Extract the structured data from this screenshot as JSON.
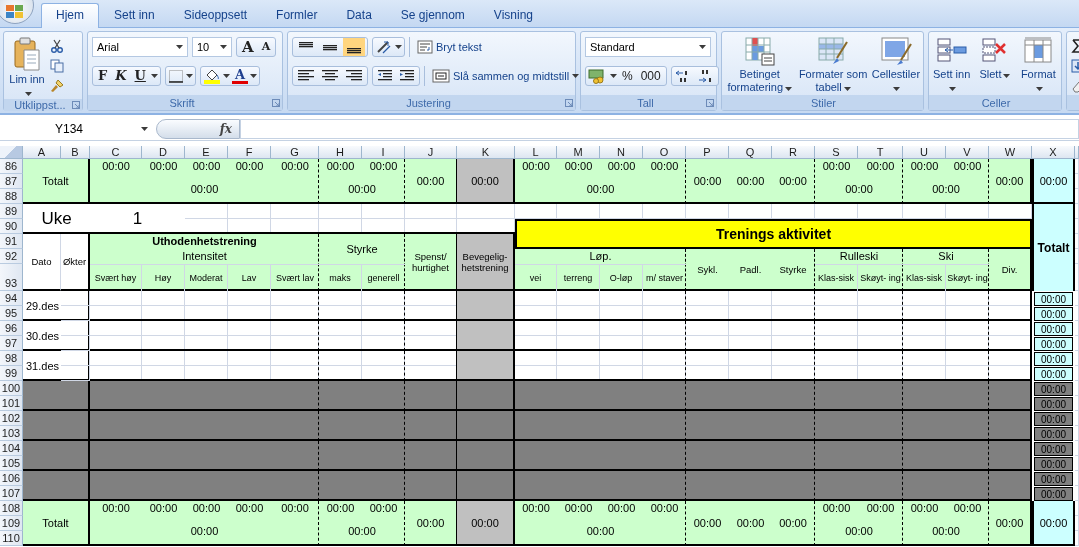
{
  "tabs": [
    {
      "label": "Hjem",
      "selected": true
    },
    {
      "label": "Sett inn",
      "selected": false
    },
    {
      "label": "Sideoppsett",
      "selected": false
    },
    {
      "label": "Formler",
      "selected": false
    },
    {
      "label": "Data",
      "selected": false
    },
    {
      "label": "Se gjennom",
      "selected": false
    },
    {
      "label": "Visning",
      "selected": false
    }
  ],
  "ribbon": {
    "clipboard": {
      "paste": "Lim inn",
      "label": "Utklippst..."
    },
    "font": {
      "name": "Arial",
      "size": "10",
      "grow": "A",
      "shrink": "A",
      "bold": "F",
      "italic": "K",
      "underline": "U",
      "text_color": "A",
      "label": "Skrift"
    },
    "alignment": {
      "vertical": [
        {
          "selected": false
        },
        {
          "selected": false
        },
        {
          "selected": true
        }
      ],
      "wrap": "Bryt tekst",
      "merge": "Slå sammen og midtstill",
      "label": "Justering"
    },
    "number": {
      "format": "Standard",
      "percent": "%",
      "thousands": "000",
      "label": "Tall"
    },
    "styles": {
      "buttons": [
        {
          "label": "Betinget formatering",
          "kind": "conditional"
        },
        {
          "label": "Formater som tabell",
          "kind": "table"
        },
        {
          "label": "Cellestiler",
          "kind": "cellstyle"
        }
      ],
      "label": "Stiler"
    },
    "cells": {
      "buttons": [
        {
          "label": "Sett inn",
          "kind": "insert"
        },
        {
          "label": "Slett",
          "kind": "delete"
        },
        {
          "label": "Format",
          "kind": "format"
        }
      ],
      "label": "Celler"
    }
  },
  "formula_bar": {
    "name_box": "Y134",
    "function_label": "fx"
  },
  "sheet": {
    "columns": [
      "A",
      "B",
      "C",
      "D",
      "E",
      "F",
      "G",
      "H",
      "I",
      "J",
      "K",
      "L",
      "M",
      "N",
      "O",
      "P",
      "Q",
      "R",
      "S",
      "T",
      "U",
      "V",
      "W",
      "X"
    ],
    "rows": [
      "86",
      "87",
      "88",
      "89",
      "90",
      "91",
      "92",
      "93",
      "94",
      "95",
      "96",
      "97",
      "98",
      "99",
      "100",
      "101",
      "102",
      "103",
      "104",
      "105",
      "106",
      "107",
      "108",
      "109",
      "110"
    ],
    "top_totals": {
      "label": "Totalt",
      "groups": [
        {
          "kind": "activity",
          "values": [
            "00:00",
            "00:00",
            "00:00",
            "00:00",
            "00:00"
          ],
          "subtotal": "00:00"
        },
        {
          "kind": "activity",
          "values": [
            "00:00",
            "00:00"
          ],
          "subtotal": "00:00"
        },
        {
          "kind": "activity",
          "values": [
            "00:00"
          ]
        },
        {
          "kind": "mobility",
          "values": [
            "00:00"
          ]
        },
        {
          "kind": "activity",
          "values": [
            "00:00",
            "00:00",
            "00:00",
            "00:00"
          ],
          "subtotal": "00:00"
        },
        {
          "kind": "activity",
          "values": [
            "00:00"
          ]
        },
        {
          "kind": "activity",
          "values": [
            "00:00"
          ]
        },
        {
          "kind": "activity",
          "values": [
            "00:00"
          ]
        },
        {
          "kind": "activity",
          "values": [
            "00:00",
            "00:00"
          ],
          "subtotal": "00:00"
        },
        {
          "kind": "activity",
          "values": [
            "00:00",
            "00:00"
          ],
          "subtotal": "00:00"
        },
        {
          "kind": "activity",
          "values": [
            "00:00"
          ]
        },
        {
          "kind": "sum",
          "values": [
            "00:00"
          ]
        }
      ]
    },
    "week": {
      "label": "Uke",
      "number": "1"
    },
    "activity_banner": "Trenings aktivitet",
    "total_header": "Totalt",
    "row_headers": [
      "Dato",
      "Økter"
    ],
    "header_groups": [
      {
        "kind": "activity",
        "title": "Uthodenhetstrening",
        "bold": true,
        "subtitle": "Intensitet",
        "columns": [
          "Svært høy",
          "Høy",
          "Moderat",
          "Lav",
          "Svært lav"
        ]
      },
      {
        "kind": "activity",
        "title": "Styrke",
        "columns": [
          "maks",
          "generell"
        ]
      },
      {
        "kind": "activity",
        "title": "Spenst/ hurtighet"
      },
      {
        "kind": "mobility",
        "title": "Bevegelig- hetstrening"
      },
      {
        "kind": "activity",
        "title": "Løp.",
        "columns": [
          "vei",
          "terreng",
          "O-løp",
          "m/ staver"
        ]
      },
      {
        "kind": "activity",
        "title": "Sykl."
      },
      {
        "kind": "activity",
        "title": "Padl."
      },
      {
        "kind": "activity",
        "title": "Styrke"
      },
      {
        "kind": "activity",
        "title": "Rulleski",
        "columns": [
          "Klas-sisk",
          "Skøyt- ing"
        ]
      },
      {
        "kind": "activity",
        "title": "Ski",
        "columns": [
          "Klas-sisk",
          "Skøyt- ing"
        ]
      },
      {
        "kind": "activity",
        "title": "Div."
      }
    ],
    "days": [
      {
        "label": "29.des",
        "kind": "open",
        "totals": [
          "00:00",
          "00:00"
        ]
      },
      {
        "label": "30.des",
        "kind": "open",
        "totals": [
          "00:00",
          "00:00"
        ]
      },
      {
        "label": "31.des",
        "kind": "open",
        "totals": [
          "00:00",
          "00:00"
        ]
      },
      {
        "kind": "blocked",
        "totals": [
          "00:00",
          "00:00"
        ]
      },
      {
        "kind": "blocked",
        "totals": [
          "00:00",
          "00:00"
        ]
      },
      {
        "kind": "blocked",
        "totals": [
          "00:00",
          "00:00"
        ]
      },
      {
        "kind": "blocked",
        "totals": [
          "00:00",
          "00:00"
        ]
      }
    ],
    "bottom_totals": {
      "label": "Totalt",
      "groups": [
        {
          "kind": "activity",
          "values": [
            "00:00",
            "00:00",
            "00:00",
            "00:00",
            "00:00"
          ],
          "subtotal": "00:00"
        },
        {
          "kind": "activity",
          "values": [
            "00:00",
            "00:00"
          ],
          "subtotal": "00:00"
        },
        {
          "kind": "activity",
          "values": [
            "00:00"
          ]
        },
        {
          "kind": "mobility",
          "values": [
            "00:00"
          ]
        },
        {
          "kind": "activity",
          "values": [
            "00:00",
            "00:00",
            "00:00",
            "00:00"
          ],
          "subtotal": "00:00"
        },
        {
          "kind": "activity",
          "values": [
            "00:00"
          ]
        },
        {
          "kind": "activity",
          "values": [
            "00:00"
          ]
        },
        {
          "kind": "activity",
          "values": [
            "00:00"
          ]
        },
        {
          "kind": "activity",
          "values": [
            "00:00",
            "00:00"
          ],
          "subtotal": "00:00"
        },
        {
          "kind": "activity",
          "values": [
            "00:00",
            "00:00"
          ],
          "subtotal": "00:00"
        },
        {
          "kind": "activity",
          "values": [
            "00:00"
          ]
        },
        {
          "kind": "sum",
          "values": [
            "00:00"
          ]
        }
      ]
    }
  }
}
